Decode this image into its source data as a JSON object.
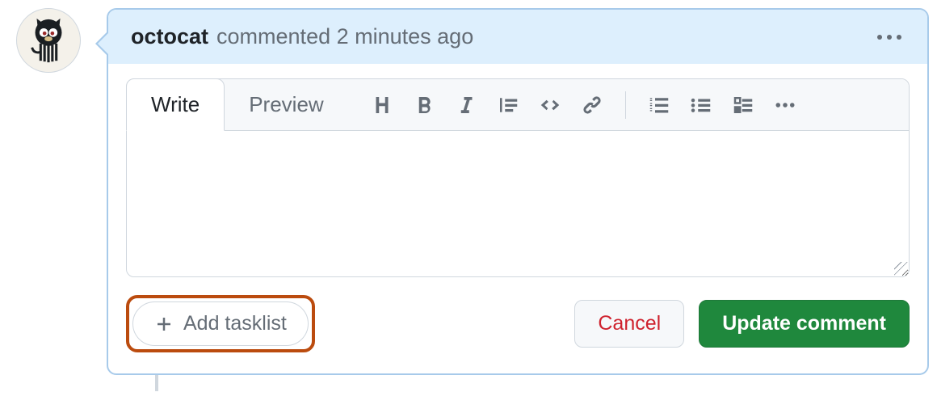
{
  "comment": {
    "author": "octocat",
    "meta": "commented 2 minutes ago"
  },
  "tabs": {
    "write": "Write",
    "preview": "Preview"
  },
  "textarea": {
    "value": "",
    "placeholder": ""
  },
  "toolbar_icons": {
    "heading": "heading-icon",
    "bold": "bold-icon",
    "italic": "italic-icon",
    "quote": "quote-icon",
    "code": "code-icon",
    "link": "link-icon",
    "ordered_list": "ordered-list-icon",
    "unordered_list": "unordered-list-icon",
    "task_list": "task-list-icon",
    "more": "more-icon"
  },
  "footer": {
    "add_tasklist": "Add tasklist",
    "cancel": "Cancel",
    "update": "Update comment"
  }
}
